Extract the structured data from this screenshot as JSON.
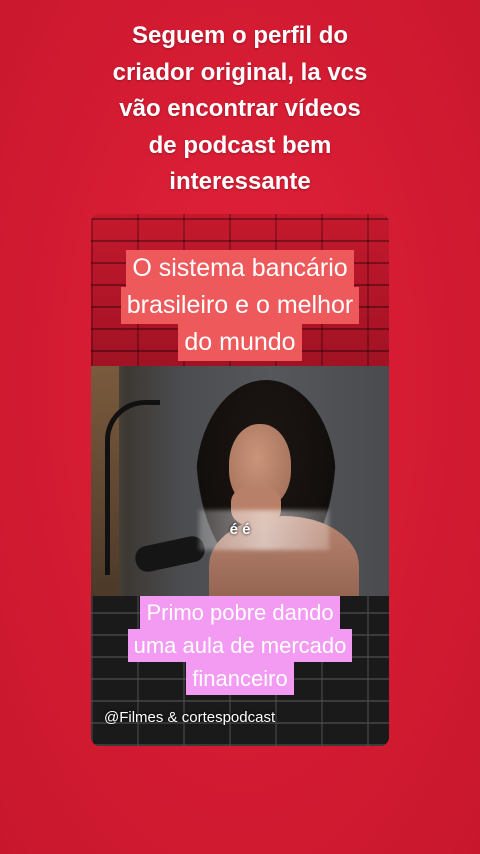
{
  "caption": {
    "lines": [
      "Seguem o perfil do",
      "criador original, la vcs",
      "vão encontrar vídeos",
      "de podcast bem",
      "interessante"
    ]
  },
  "video": {
    "top_label_lines": [
      "O sistema bancário",
      "brasileiro e o melhor",
      "do mundo"
    ],
    "subtitle": "é é",
    "bottom_label_lines": [
      "Primo pobre dando",
      "uma aula de mercado",
      "financeiro"
    ],
    "handle": "@Filmes & cortespodcast"
  },
  "colors": {
    "background": "#d31b32",
    "top_label_bg": "#ee5a5c",
    "bottom_label_bg": "#f39af3"
  }
}
